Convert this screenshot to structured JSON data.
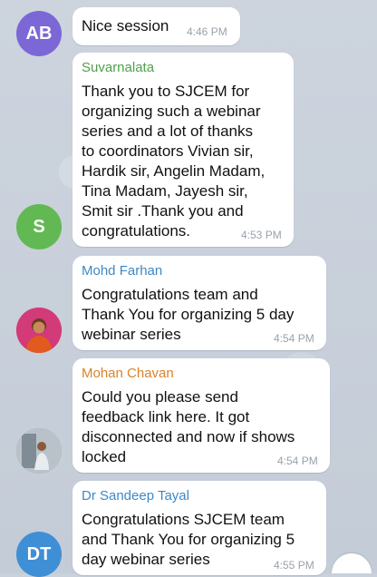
{
  "messages": [
    {
      "avatar_initials": "AB",
      "avatar_color": "#7b68d6",
      "sender": "",
      "text": "Nice session",
      "time": "4:46 PM"
    },
    {
      "avatar_initials": "S",
      "avatar_color": "#62b953",
      "sender": "Suvarnalata",
      "sender_color": "#4fa04a",
      "text": "Thank you to SJCEM for\norganizing such a webinar\nseries and a lot of thanks\nto coordinators Vivian sir,\nHardik sir, Angelin Madam,\nTina Madam, Jayesh sir,\nSmit sir .Thank you and\ncongratulations.",
      "time": "4:53 PM"
    },
    {
      "avatar_initials": "",
      "avatar_color": "#c0306a",
      "sender": "Mohd Farhan",
      "sender_color": "#3f88c5",
      "text": "Congratulations team and\nThank You for organizing 5 day\nwebinar series",
      "time": "4:54 PM"
    },
    {
      "avatar_initials": "",
      "avatar_color": "#9aa4ad",
      "sender": "Mohan Chavan",
      "sender_color": "#d9822b",
      "text": "Could you please send\nfeedback link here. It got\ndisconnected and now if shows\nlocked",
      "time": "4:54 PM"
    },
    {
      "avatar_initials": "DT",
      "avatar_color": "#3f8fd6",
      "sender": "Dr Sandeep Tayal",
      "sender_color": "#3f88c5",
      "text": "Congratulations SJCEM team\nand Thank You for organizing 5\nday webinar series",
      "time": "4:55 PM"
    }
  ]
}
